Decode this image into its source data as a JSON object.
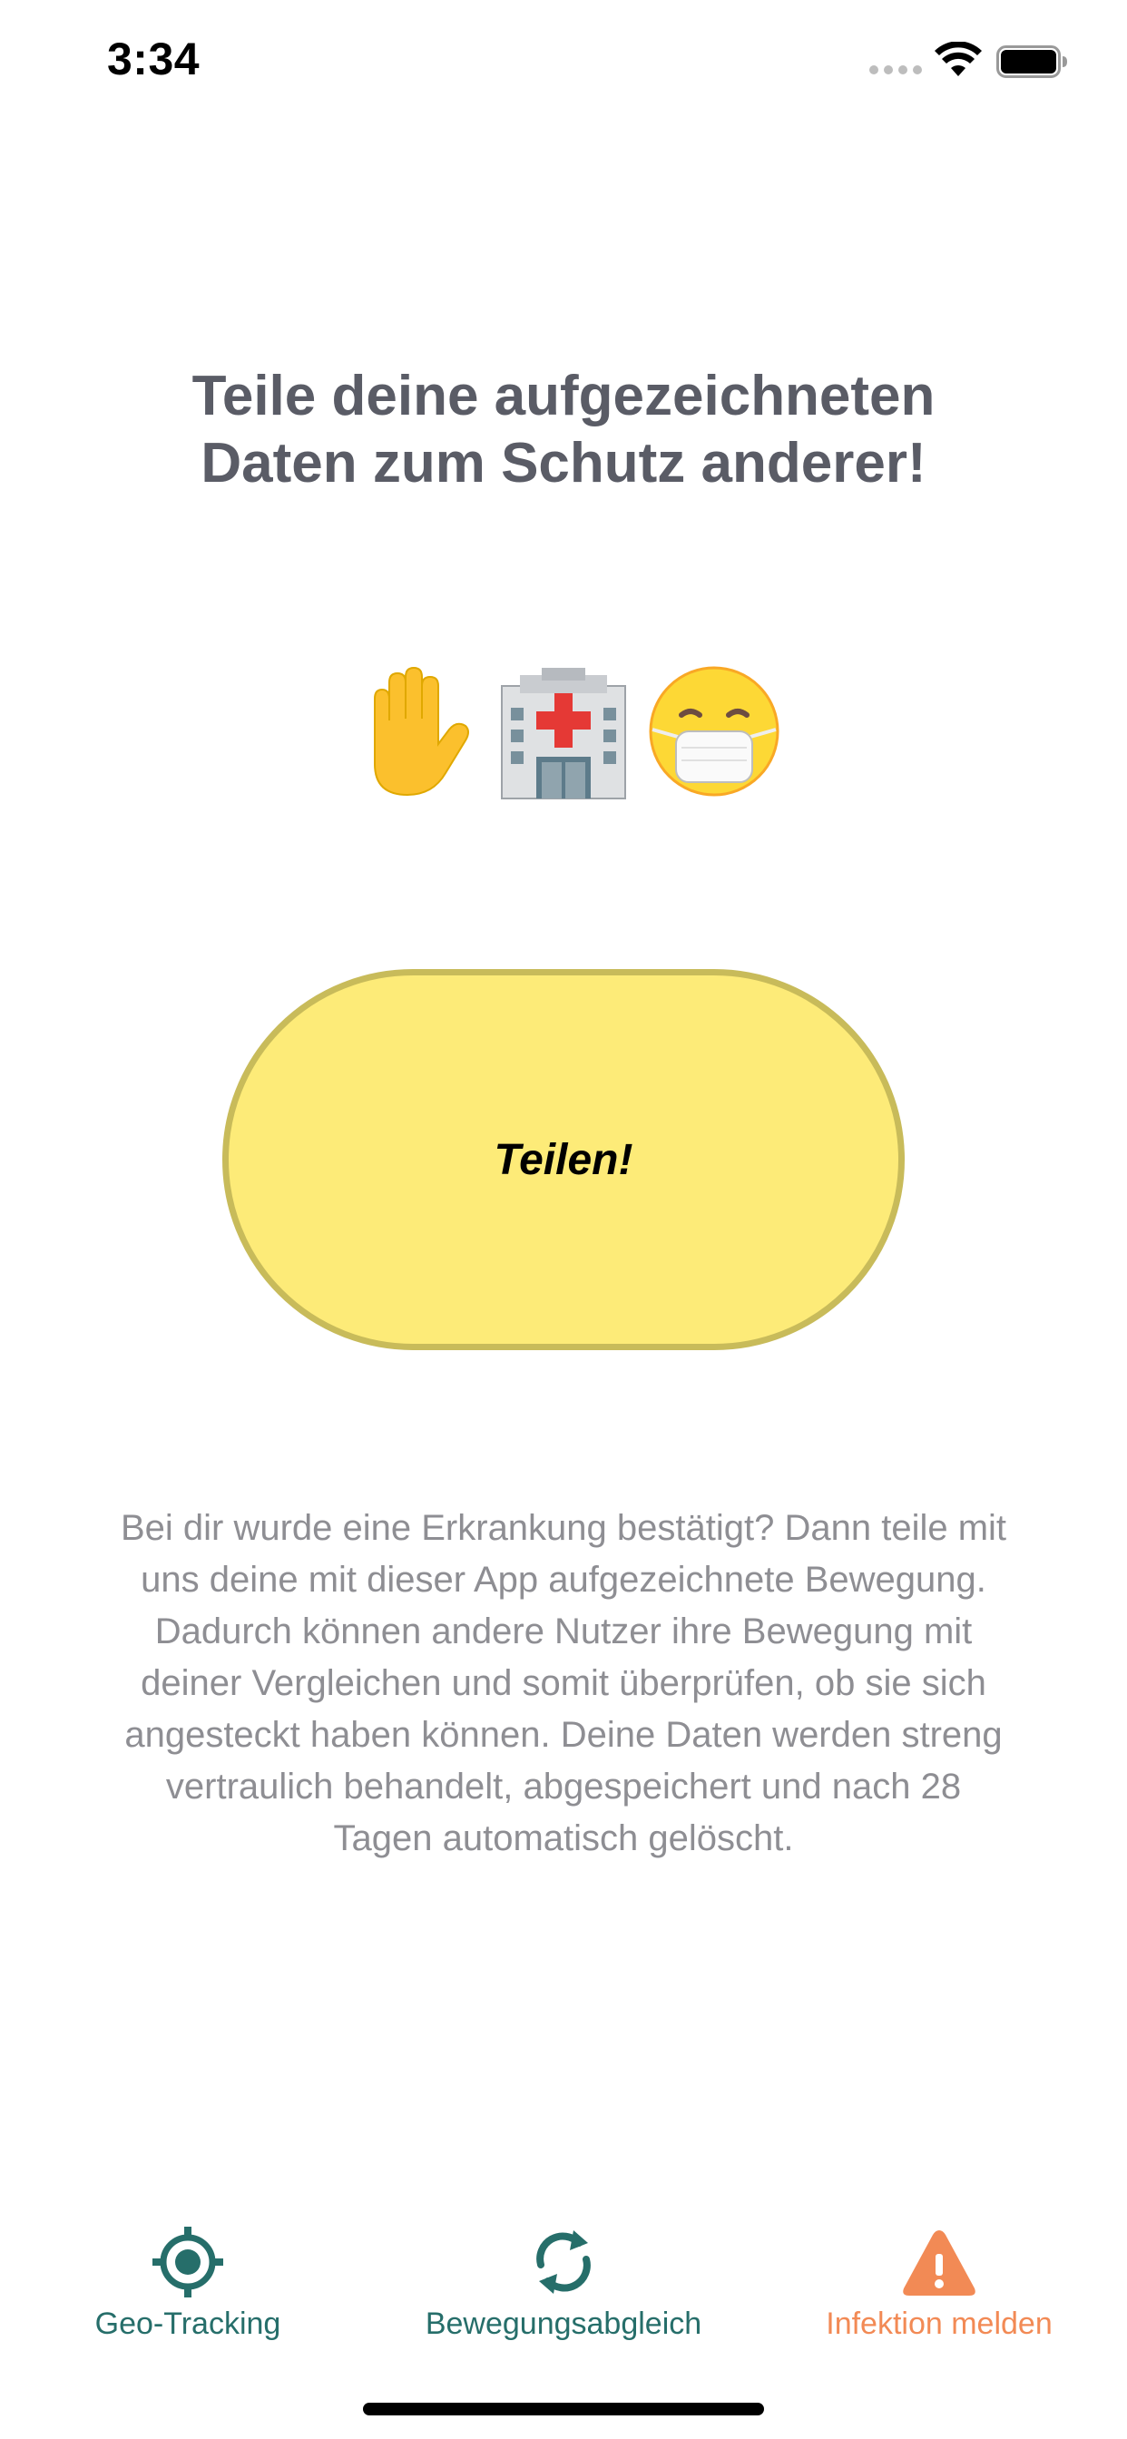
{
  "status_bar": {
    "time": "3:34",
    "icons": [
      "signal-icon",
      "wifi-icon",
      "battery-icon"
    ]
  },
  "headline": {
    "line1": "Teile deine aufgezeichneten",
    "line2": "Daten zum Schutz anderer!"
  },
  "emojis": [
    "raised-hand-icon",
    "hospital-icon",
    "face-with-mask-icon"
  ],
  "share_button": {
    "label": "Teilen!"
  },
  "description": "Bei dir wurde eine Erkrankung bestätigt? Dann teile mit uns deine mit dieser App aufgezeichnete Bewegung. Dadurch können andere Nutzer ihre Bewegung mit deiner Vergleichen und somit überprüfen, ob sie sich angesteckt haben können. Deine Daten werden streng vertraulich behandelt, abgespeichert und nach 28 Tagen automatisch gelöscht.",
  "tab_bar": {
    "tabs": [
      {
        "label": "Geo-Tracking",
        "icon": "target-icon",
        "active": false
      },
      {
        "label": "Bewegungsabgleich",
        "icon": "sync-icon",
        "active": false
      },
      {
        "label": "Infektion melden",
        "icon": "warning-icon",
        "active": true
      }
    ]
  },
  "colors": {
    "headline": "#5a5c66",
    "button_fill": "#fdeb78",
    "button_border": "#c8bb5a",
    "tab_inactive": "#266e6a",
    "tab_active": "#f28a55",
    "body_text": "#8e8e93"
  }
}
